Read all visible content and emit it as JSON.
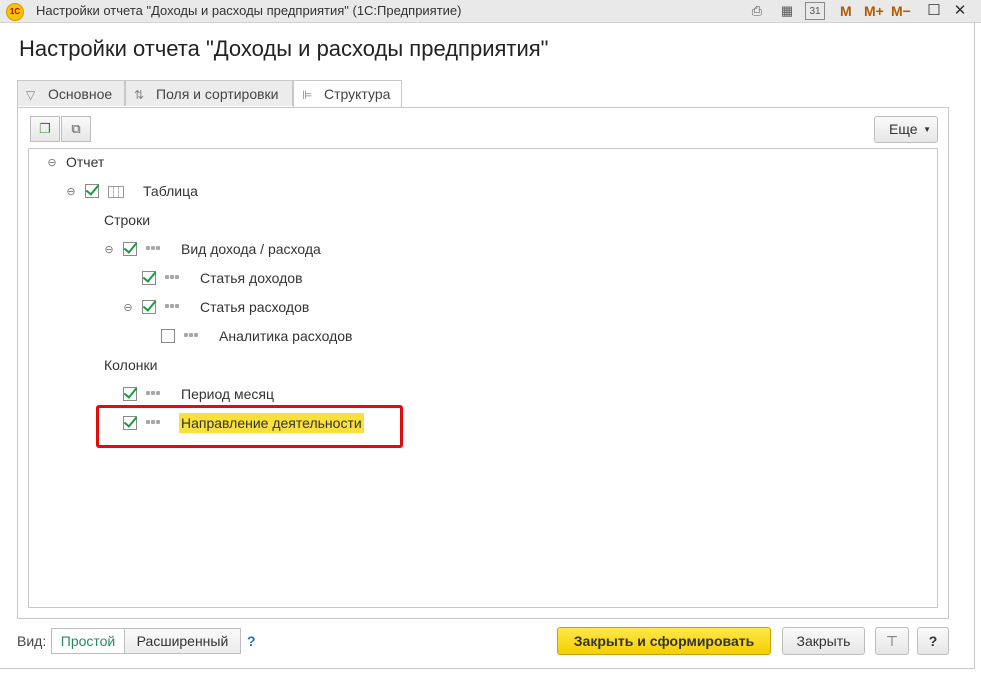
{
  "window": {
    "logo_text": "1С",
    "title": "Настройки отчета \"Доходы и расходы предприятия\"  (1С:Предприятие)",
    "m_labels": [
      "M",
      "M+",
      "M−"
    ]
  },
  "page_title": "Настройки отчета \"Доходы и расходы предприятия\"",
  "tabs": [
    {
      "label": "Основное",
      "icon": "filter-icon",
      "active": false
    },
    {
      "label": "Поля и сортировки",
      "icon": "fields-sort-icon",
      "active": false
    },
    {
      "label": "Структура",
      "icon": "structure-icon",
      "active": true
    }
  ],
  "toolbar": {
    "more_label": "Еще"
  },
  "tree": {
    "root": "Отчет",
    "table": "Таблица",
    "rows_group": "Строки",
    "income_expense_type": "Вид дохода / расхода",
    "income_item": "Статья доходов",
    "expense_item": "Статья расходов",
    "expense_analytics": "Аналитика расходов",
    "columns_group": "Колонки",
    "period_month": "Период месяц",
    "activity_direction": "Направление деятельности"
  },
  "footer": {
    "view_label": "Вид:",
    "view_options": [
      "Простой",
      "Расширенный"
    ],
    "help": "?",
    "generate_button": "Закрыть и сформировать",
    "close_button": "Закрыть",
    "help_button": "?"
  },
  "colors": {
    "highlight": "#f9e03c",
    "annotation": "#e00d0d",
    "primary_button": "#f4cf00",
    "check": "#1a9b3a"
  }
}
